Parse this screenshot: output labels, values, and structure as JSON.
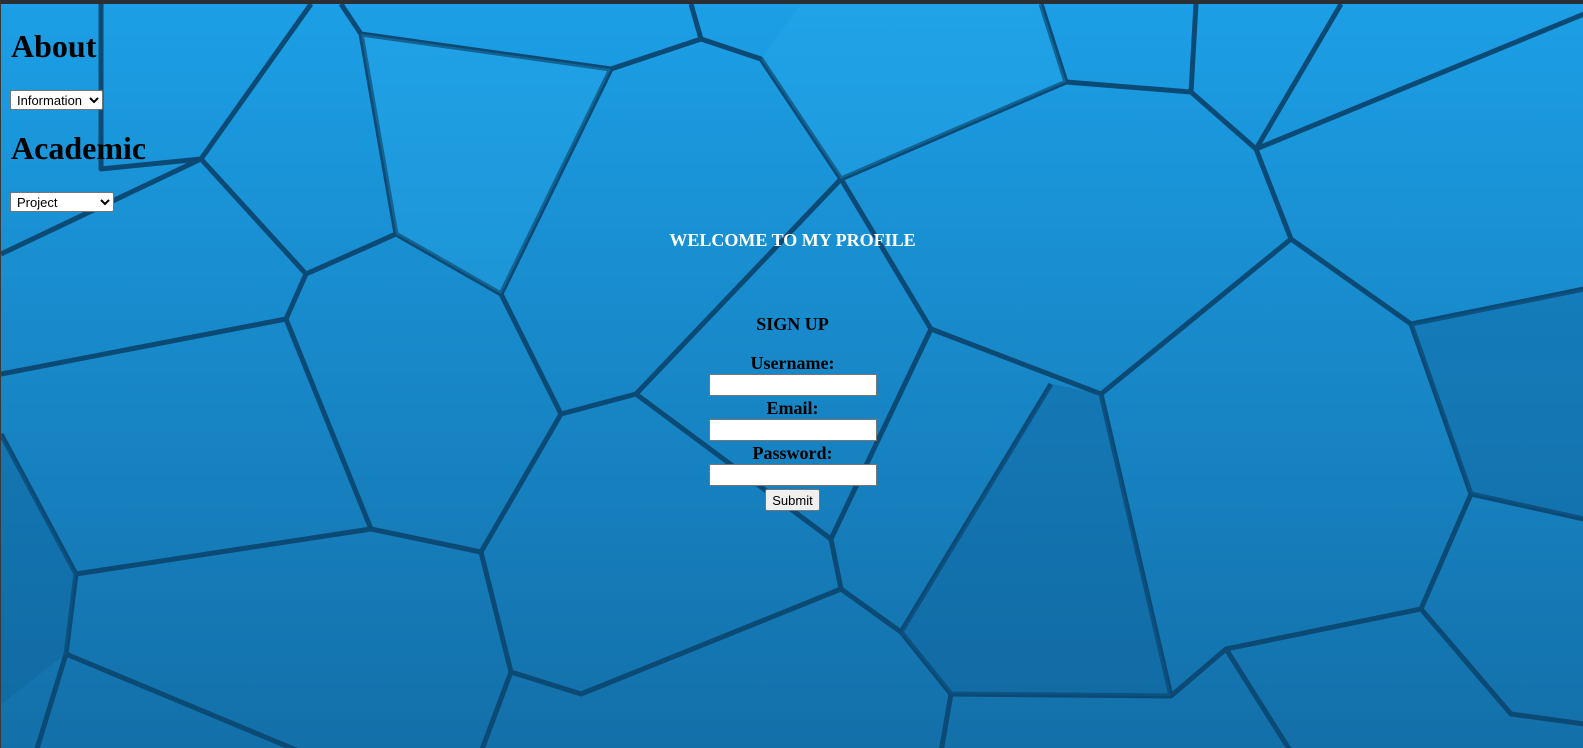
{
  "about": {
    "title": "About",
    "select_value": "Information"
  },
  "academic": {
    "title": "Academic",
    "select_value": "Project"
  },
  "welcome": "WELCOME TO MY PROFILE",
  "signup": {
    "title": "SIGN UP",
    "username_label": "Username:",
    "email_label": "Email:",
    "password_label": "Password:",
    "submit_label": "Submit"
  },
  "colors": {
    "background": "#1a86c9",
    "welcome_text": "#ffffff"
  }
}
